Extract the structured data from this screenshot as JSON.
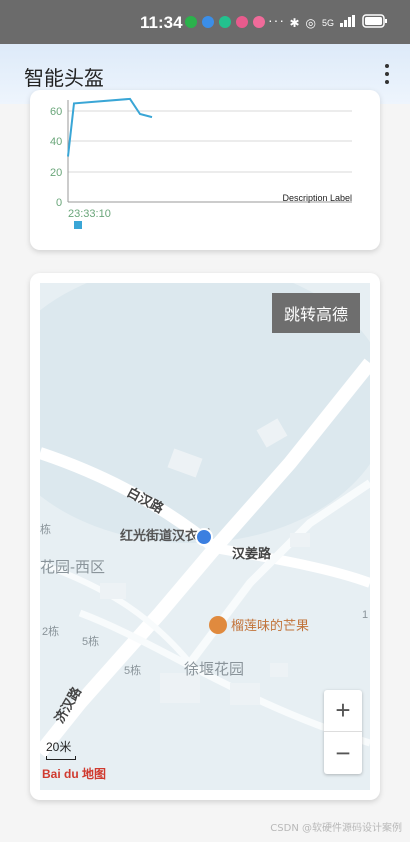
{
  "status_bar": {
    "time": "11:34",
    "more": "···",
    "network": "5G",
    "battery_icon": "battery-icon"
  },
  "app_bar": {
    "title": "智能头盔",
    "menu_icon": "more-vert-icon"
  },
  "chart_data": {
    "type": "line",
    "y_ticks": [
      "60",
      "40",
      "20",
      "0"
    ],
    "x_tick": "23:33:10",
    "description": "Description Label",
    "values": [
      30,
      65,
      68,
      58,
      56
    ],
    "ylim": [
      0,
      70
    ],
    "line_color": "#3aa6d6",
    "legend_color": "#3aa6d6"
  },
  "map": {
    "jump_button": "跳转高德",
    "labels": {
      "road1": "白汉路",
      "road2": "红光街道汉衣材",
      "road3": "汉姜路",
      "area1": "花园-西区",
      "poi": "榴莲味的芒果",
      "area2": "徐堰花园",
      "b1": "栋",
      "b2": "2栋",
      "b3": "5栋",
      "b4": "5栋",
      "road4": "济汉路",
      "edge": "1"
    },
    "zoom_in": "+",
    "zoom_out": "−",
    "scale": "20米",
    "logo": "Bai du 地图"
  },
  "watermark": "CSDN @软硬件源码设计案例"
}
